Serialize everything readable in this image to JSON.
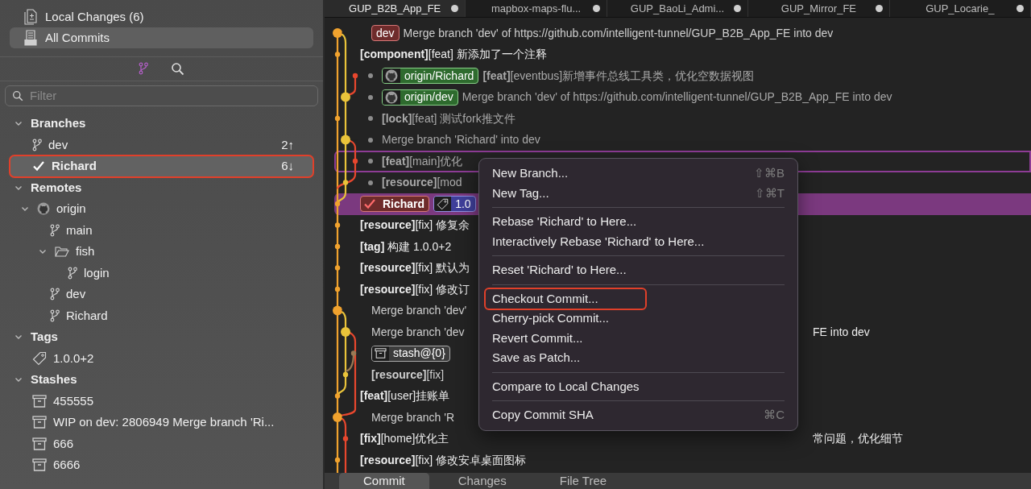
{
  "sidebar": {
    "nav": [
      {
        "kind": "changes",
        "label": "Local Changes (6)",
        "selected": false
      },
      {
        "kind": "commits",
        "label": "All Commits",
        "selected": true
      }
    ],
    "modes": [
      {
        "kind": "branches",
        "selected": true
      },
      {
        "kind": "search",
        "selected": false
      }
    ],
    "filter": {
      "placeholder": "Filter"
    },
    "sections": [
      {
        "title": "Branches",
        "expanded": true,
        "items": [
          {
            "kind": "branch",
            "label": "dev",
            "count": "2↑",
            "selected": false,
            "checked": false,
            "annotated": false
          },
          {
            "kind": "branch",
            "label": "Richard",
            "count": "6↓",
            "selected": true,
            "checked": true,
            "annotated": true
          }
        ]
      },
      {
        "title": "Remotes",
        "expanded": true,
        "items": [
          {
            "kind": "remote",
            "label": "origin",
            "expanded": true,
            "children": [
              {
                "kind": "branch",
                "label": "main"
              },
              {
                "kind": "folder",
                "label": "fish",
                "expanded": true,
                "children": [
                  {
                    "kind": "branch",
                    "label": "login"
                  }
                ]
              },
              {
                "kind": "branch",
                "label": "dev"
              },
              {
                "kind": "branch",
                "label": "Richard"
              }
            ]
          }
        ]
      },
      {
        "title": "Tags",
        "expanded": true,
        "items": [
          {
            "kind": "tag",
            "label": "1.0.0+2"
          }
        ]
      },
      {
        "title": "Stashes",
        "expanded": true,
        "items": [
          {
            "kind": "stash",
            "label": "455555"
          },
          {
            "kind": "stash",
            "label": "WIP on dev: 2806949 Merge branch 'Ri..."
          },
          {
            "kind": "stash",
            "label": "666"
          },
          {
            "kind": "stash",
            "label": "6666"
          }
        ]
      }
    ]
  },
  "tabs": [
    {
      "label": "GUP_B2B_App_FE",
      "selected": true
    },
    {
      "label": "mapbox-maps-flu...",
      "selected": false
    },
    {
      "label": "GUP_BaoLi_Admi...",
      "selected": false
    },
    {
      "label": "GUP_Mirror_FE",
      "selected": false
    },
    {
      "label": "GUP_Locarie_",
      "selected": false
    }
  ],
  "commits": [
    {
      "kind": "merge",
      "refs": [
        {
          "kind": "local",
          "label": "dev",
          "checked": false
        }
      ],
      "message": "Merge branch 'dev' of https://github.com/intelligent-tunnel/GUP_B2B_App_FE into dev",
      "selected": false,
      "context_target": false
    },
    {
      "kind": "commit",
      "message": "**[component]**[feat] 新添加了一个注释",
      "selected": false,
      "context_target": false
    },
    {
      "kind": "side",
      "refs": [
        {
          "kind": "remote",
          "label": "origin/Richard"
        }
      ],
      "message": "**[feat]**[eventbus]新增事件总线工具类，优化空数据视图",
      "selected": false,
      "context_target": false
    },
    {
      "kind": "side",
      "refs": [
        {
          "kind": "remote",
          "label": "origin/dev"
        }
      ],
      "message": "Merge branch 'dev' of https://github.com/intelligent-tunnel/GUP_B2B_App_FE into dev",
      "selected": false,
      "context_target": false
    },
    {
      "kind": "side",
      "message": "**[lock]**[feat] 测试fork推文件",
      "selected": false,
      "context_target": false
    },
    {
      "kind": "side",
      "message": "Merge branch 'Richard' into dev",
      "selected": false,
      "context_target": false
    },
    {
      "kind": "side",
      "message": "**[feat]**[main]优化",
      "selected": false,
      "context_target": true
    },
    {
      "kind": "side",
      "message": "**[resource]**[mod",
      "selected": false,
      "context_target": false
    },
    {
      "kind": "commit",
      "refs": [
        {
          "kind": "local",
          "label": "Richard",
          "checked": true
        },
        {
          "kind": "tag",
          "label": "1.0"
        }
      ],
      "selected": true,
      "context_target": false
    },
    {
      "kind": "commit",
      "message": "**[resource]**[fix] 修复余",
      "selected": false,
      "context_target": false
    },
    {
      "kind": "commit",
      "message": "**[tag]** 构建 1.0.0+2",
      "selected": false,
      "context_target": false
    },
    {
      "kind": "commit",
      "message": "**[resource]**[fix] 默认为",
      "selected": false,
      "context_target": false
    },
    {
      "kind": "commit",
      "message": "**[resource]**[fix] 修改订",
      "selected": false,
      "context_target": false
    },
    {
      "kind": "merge",
      "message": "Merge branch 'dev'",
      "selected": false,
      "context_target": false
    },
    {
      "kind": "merge",
      "message": "Merge branch 'dev",
      "tail": "FE into dev",
      "selected": false,
      "context_target": false
    },
    {
      "kind": "merge",
      "refs": [
        {
          "kind": "stash",
          "label": "stash@{0}"
        }
      ],
      "selected": false,
      "context_target": false
    },
    {
      "kind": "merge",
      "message": "**[resource]**[fix]",
      "selected": false,
      "context_target": false
    },
    {
      "kind": "commit",
      "message": "**[feat]**[user]挂账单",
      "selected": false,
      "context_target": false
    },
    {
      "kind": "merge",
      "message": "Merge branch 'R",
      "selected": false,
      "context_target": false
    },
    {
      "kind": "commit",
      "message": "**[fix]**[home]优化主",
      "tail": "常问题，优化细节",
      "selected": false,
      "context_target": false
    },
    {
      "kind": "commit",
      "message": "**[resource]**[fix] 修改安卓桌面图标",
      "selected": false,
      "context_target": false
    }
  ],
  "context_menu": {
    "items": [
      {
        "kind": "item",
        "label": "New Branch...",
        "shortcut": "⇧⌘B",
        "annotated": false
      },
      {
        "kind": "item",
        "label": "New Tag...",
        "shortcut": "⇧⌘T",
        "annotated": false
      },
      {
        "kind": "separator"
      },
      {
        "kind": "item",
        "label": "Rebase 'Richard' to Here...",
        "annotated": false
      },
      {
        "kind": "item",
        "label": "Interactively Rebase 'Richard' to Here...",
        "annotated": false
      },
      {
        "kind": "separator"
      },
      {
        "kind": "item",
        "label": "Reset 'Richard' to Here...",
        "annotated": false
      },
      {
        "kind": "separator"
      },
      {
        "kind": "item",
        "label": "Checkout Commit...",
        "annotated": true
      },
      {
        "kind": "item",
        "label": "Cherry-pick Commit...",
        "annotated": false
      },
      {
        "kind": "item",
        "label": "Revert Commit...",
        "annotated": false
      },
      {
        "kind": "item",
        "label": "Save as Patch...",
        "annotated": false
      },
      {
        "kind": "separator"
      },
      {
        "kind": "item",
        "label": "Compare to Local Changes",
        "annotated": false
      },
      {
        "kind": "separator"
      },
      {
        "kind": "item",
        "label": "Copy Commit SHA",
        "shortcut": "⌘C",
        "annotated": false
      }
    ]
  },
  "bottom_tabs": [
    {
      "label": "Commit",
      "selected": true
    },
    {
      "label": "Changes",
      "selected": false
    },
    {
      "label": "File Tree",
      "selected": false
    }
  ]
}
